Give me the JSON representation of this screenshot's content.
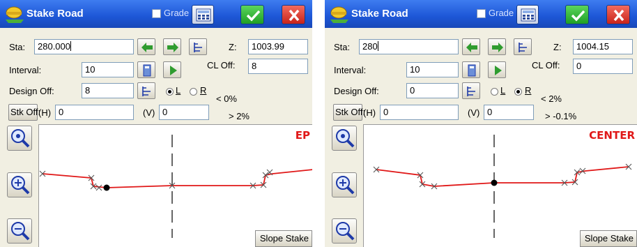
{
  "colors": {
    "title_bar": "#1d56d6",
    "profile_line": "#e01818",
    "point_label": "#e01818"
  },
  "panels": [
    {
      "title": "Stake Road",
      "grade_label": "Grade",
      "sta_label": "Sta:",
      "sta_value": "280.000",
      "z_label": "Z:",
      "z_value": "1003.99",
      "interval_label": "Interval:",
      "interval_value": "10",
      "cl_off_label": "CL Off:",
      "cl_off_value": "8",
      "design_off_label": "Design Off:",
      "design_off_value": "8",
      "side_left": "L",
      "side_right": "R",
      "side_selected": "L",
      "slope_top": "< 0%",
      "slope_bottom": "> 2%",
      "stk_off_label": "Stk Off:",
      "h_label": "(H)",
      "h_value": "0",
      "v_label": "(V)",
      "v_value": "0",
      "point_label": "EP",
      "slope_stake_label": "Slope Stake",
      "icons": [
        "stake-road-app-icon",
        "calculator-icon",
        "checkmark-icon",
        "close-icon",
        "arrow-left-icon",
        "arrow-right-icon",
        "station-list-icon",
        "interval-calc-icon",
        "play-icon",
        "zoom-extents-icon",
        "zoom-in-icon",
        "zoom-out-icon"
      ]
    },
    {
      "title": "Stake Road",
      "grade_label": "Grade",
      "sta_label": "Sta:",
      "sta_value": "280",
      "z_label": "Z:",
      "z_value": "1004.15",
      "interval_label": "Interval:",
      "interval_value": "10",
      "cl_off_label": "CL Off:",
      "cl_off_value": "0",
      "design_off_label": "Design Off:",
      "design_off_value": "0",
      "side_left": "L",
      "side_right": "R",
      "side_selected": "R",
      "slope_top": "< 2%",
      "slope_bottom": "> -0.1%",
      "stk_off_label": "Stk Off:",
      "h_label": "(H)",
      "h_value": "0",
      "v_label": "(V)",
      "v_value": "0",
      "point_label": "CENTER",
      "slope_stake_label": "Slope Stake",
      "icons": [
        "stake-road-app-icon",
        "calculator-icon",
        "checkmark-icon",
        "close-icon",
        "arrow-left-icon",
        "arrow-right-icon",
        "station-list-icon",
        "interval-calc-icon",
        "play-icon",
        "zoom-extents-icon",
        "zoom-in-icon",
        "zoom-out-icon"
      ]
    }
  ]
}
